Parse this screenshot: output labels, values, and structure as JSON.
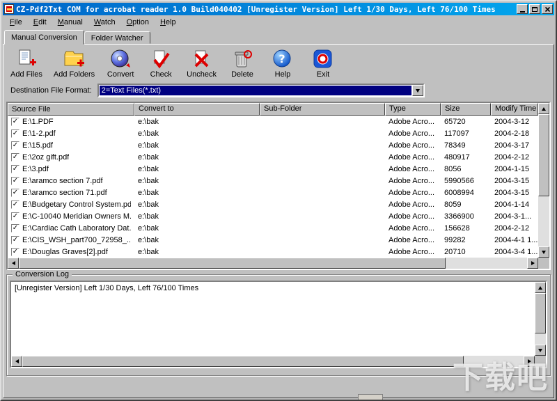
{
  "window": {
    "title": "CZ-Pdf2Txt COM for acrobat reader 1.0 Build040402 [Unregister Version] Left 1/30 Days, Left 76/100 Times"
  },
  "menu": {
    "items": [
      "File",
      "Edit",
      "Manual",
      "Watch",
      "Option",
      "Help"
    ]
  },
  "tabs": [
    {
      "label": "Manual Conversion",
      "active": true
    },
    {
      "label": "Folder Watcher",
      "active": false
    }
  ],
  "toolbar": {
    "buttons": [
      {
        "label": "Add Files",
        "icon": "add-files-icon"
      },
      {
        "label": "Add Folders",
        "icon": "add-folders-icon"
      },
      {
        "label": "Convert",
        "icon": "convert-icon"
      },
      {
        "label": "Check",
        "icon": "check-icon"
      },
      {
        "label": "Uncheck",
        "icon": "uncheck-icon"
      },
      {
        "label": "Delete",
        "icon": "delete-icon"
      },
      {
        "label": "Help",
        "icon": "help-icon"
      },
      {
        "label": "Exit",
        "icon": "exit-icon"
      }
    ]
  },
  "destination": {
    "label": "Destination File Format:",
    "value": "2=Text Files(*.txt)"
  },
  "table": {
    "headers": [
      "Source File",
      "Convert to",
      "Sub-Folder",
      "Type",
      "Size",
      "Modify Time"
    ],
    "rows": [
      {
        "checked": true,
        "source": "E:\\1.PDF",
        "convert_to": "e:\\bak",
        "sub_folder": "",
        "type": "Adobe Acro...",
        "size": "65720",
        "modified": "2004-3-12"
      },
      {
        "checked": true,
        "source": "E:\\1-2.pdf",
        "convert_to": "e:\\bak",
        "sub_folder": "",
        "type": "Adobe Acro...",
        "size": "117097",
        "modified": "2004-2-18"
      },
      {
        "checked": true,
        "source": "E:\\15.pdf",
        "convert_to": "e:\\bak",
        "sub_folder": "",
        "type": "Adobe Acro...",
        "size": "78349",
        "modified": "2004-3-17"
      },
      {
        "checked": true,
        "source": "E:\\2oz gift.pdf",
        "convert_to": "e:\\bak",
        "sub_folder": "",
        "type": "Adobe Acro...",
        "size": "480917",
        "modified": "2004-2-12"
      },
      {
        "checked": true,
        "source": "E:\\3.pdf",
        "convert_to": "e:\\bak",
        "sub_folder": "",
        "type": "Adobe Acro...",
        "size": "8056",
        "modified": "2004-1-15"
      },
      {
        "checked": true,
        "source": "E:\\aramco section 7.pdf",
        "convert_to": "e:\\bak",
        "sub_folder": "",
        "type": "Adobe Acro...",
        "size": "5990566",
        "modified": "2004-3-15"
      },
      {
        "checked": true,
        "source": "E:\\aramco section 71.pdf",
        "convert_to": "e:\\bak",
        "sub_folder": "",
        "type": "Adobe Acro...",
        "size": "6008994",
        "modified": "2004-3-15"
      },
      {
        "checked": true,
        "source": "E:\\Budgetary Control System.pdf",
        "convert_to": "e:\\bak",
        "sub_folder": "",
        "type": "Adobe Acro...",
        "size": "8059",
        "modified": "2004-1-14"
      },
      {
        "checked": true,
        "source": "E:\\C-10040 Meridian Owners M...",
        "convert_to": "e:\\bak",
        "sub_folder": "",
        "type": "Adobe Acro...",
        "size": "3366900",
        "modified": "2004-3-1..."
      },
      {
        "checked": true,
        "source": "E:\\Cardiac Cath Laboratory Dat...",
        "convert_to": "e:\\bak",
        "sub_folder": "",
        "type": "Adobe Acro...",
        "size": "156628",
        "modified": "2004-2-12"
      },
      {
        "checked": true,
        "source": "E:\\CIS_WSH_part700_72958_...",
        "convert_to": "e:\\bak",
        "sub_folder": "",
        "type": "Adobe Acro...",
        "size": "99282",
        "modified": "2004-4-1 1..."
      },
      {
        "checked": true,
        "source": "E:\\Douglas Graves[2].pdf",
        "convert_to": "e:\\bak",
        "sub_folder": "",
        "type": "Adobe Acro...",
        "size": "20710",
        "modified": "2004-3-4 1..."
      }
    ]
  },
  "log": {
    "title": "Conversion Log",
    "text": "[Unregister Version] Left 1/30 Days, Left 76/100 Times"
  },
  "watermark": "下载吧",
  "colors": {
    "titlebar_start": "#0166c8",
    "titlebar_end": "#02a7ee",
    "selection": "#000080",
    "chrome": "#c0c0c0"
  }
}
